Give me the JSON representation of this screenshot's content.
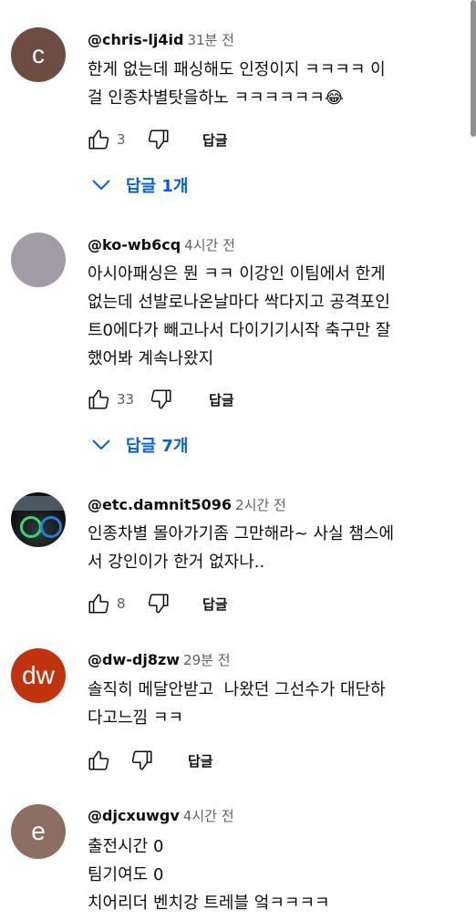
{
  "comments": [
    {
      "avatar_letter": "c",
      "avatar_color": "#6d4c41",
      "handle": "@chris-lj4id",
      "time": "31분 전",
      "text": "한게 없는데 패싱해도 인정이지 ㅋㅋㅋㅋ 이\n걸 인종차별탓을하노 ㅋㅋㅋㅋㅋㅋ😂",
      "likes": "3",
      "reply_label": "답글",
      "replies_label": "답글 1개"
    },
    {
      "avatar_letter": "",
      "avatar_color": "#a19ca8",
      "handle": "@ko-wb6cq",
      "time": "4시간 전",
      "text": "아시아패싱은 뭔 ㅋㅋ 이강인 이팀에서 한게\n없는데 선발로나온날마다 싹다지고 공격포인\n트0에다가 빼고나서 다이기기시작 축구만 잘\n했어봐 계속나왔지",
      "likes": "33",
      "reply_label": "답글",
      "replies_label": "답글 7개"
    },
    {
      "avatar_letter": "",
      "avatar_color": "#1a1a1a",
      "handle": "@etc.damnit5096",
      "time": "2시간 전",
      "text": "인종차별 몰아가기좀 그만해라~ 사실 챔스에\n서 강인이가 한거 없자나..",
      "likes": "8",
      "reply_label": "답글"
    },
    {
      "avatar_letter": "dw",
      "avatar_color": "#c1330f",
      "handle": "@dw-dj8zw",
      "time": "29분 전",
      "text": "솔직히 메달안받고  나왔던 그선수가 대단하\n다고느낌 ㅋㅋ",
      "likes": "",
      "reply_label": "답글"
    },
    {
      "avatar_letter": "e",
      "avatar_color": "#8d6e63",
      "handle": "@djcxuwgv",
      "time": "4시간 전",
      "text": "출전시간 0\n팀기여도 0\n치어리더 벤치강 트레블 엌ㅋㅋㅋㅋ"
    }
  ]
}
